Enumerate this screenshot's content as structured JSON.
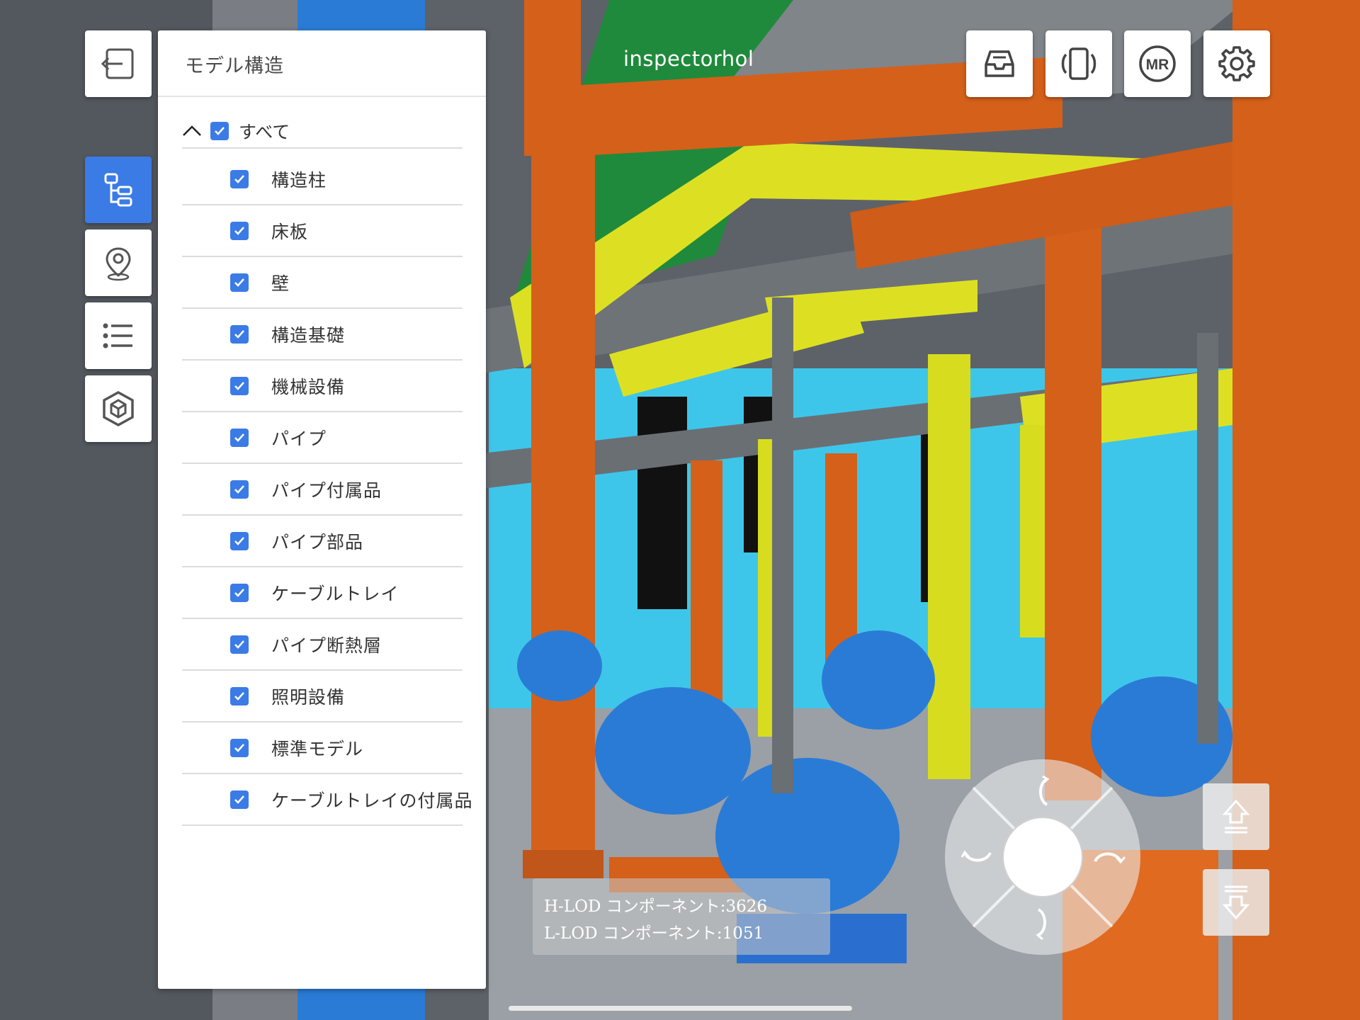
{
  "panel": {
    "title": "モデル構造",
    "root": {
      "label": "すべて",
      "checked": true
    },
    "items": [
      {
        "label": "構造柱",
        "checked": true
      },
      {
        "label": "床板",
        "checked": true
      },
      {
        "label": "壁",
        "checked": true
      },
      {
        "label": "構造基礎",
        "checked": true
      },
      {
        "label": "機械設備",
        "checked": true
      },
      {
        "label": "パイプ",
        "checked": true
      },
      {
        "label": "パイプ付属品",
        "checked": true
      },
      {
        "label": "パイプ部品",
        "checked": true
      },
      {
        "label": "ケーブルトレイ",
        "checked": true
      },
      {
        "label": "パイプ断熱層",
        "checked": true
      },
      {
        "label": "照明設備",
        "checked": true
      },
      {
        "label": "標準モデル",
        "checked": true
      },
      {
        "label": "ケーブルトレイの付属品",
        "checked": true
      }
    ]
  },
  "viewer": {
    "title": "inspectorhol",
    "lod": {
      "h_lod": "H-LOD コンポーネント:3626",
      "l_lod": "L-LOD コンポーネント:1051"
    }
  },
  "sidebar": {
    "buttons": [
      {
        "icon": "exit-icon",
        "active": false
      },
      {
        "icon": "tree-structure-icon",
        "active": true
      },
      {
        "icon": "location-pin-icon",
        "active": false
      },
      {
        "icon": "list-icon",
        "active": false
      },
      {
        "icon": "cube-icon",
        "active": false
      }
    ]
  },
  "toolbar": {
    "buttons": [
      {
        "icon": "inbox-tray-icon"
      },
      {
        "icon": "rotate-device-icon"
      },
      {
        "icon": "mr-icon",
        "label": "MR"
      },
      {
        "icon": "gear-icon"
      }
    ]
  },
  "controls": {
    "joystick_icons": [
      "rotate-up-icon",
      "rotate-left-icon",
      "rotate-right-icon",
      "rotate-down-icon"
    ],
    "floor_buttons": [
      "floor-up-icon",
      "floor-down-icon"
    ]
  },
  "colors": {
    "accent": "#3b7be6",
    "pipe_orange": "#d5601a",
    "pipe_yellow": "#e0e020",
    "equipment_blue": "#2a7bd6",
    "water_cyan": "#3ec6ea"
  }
}
